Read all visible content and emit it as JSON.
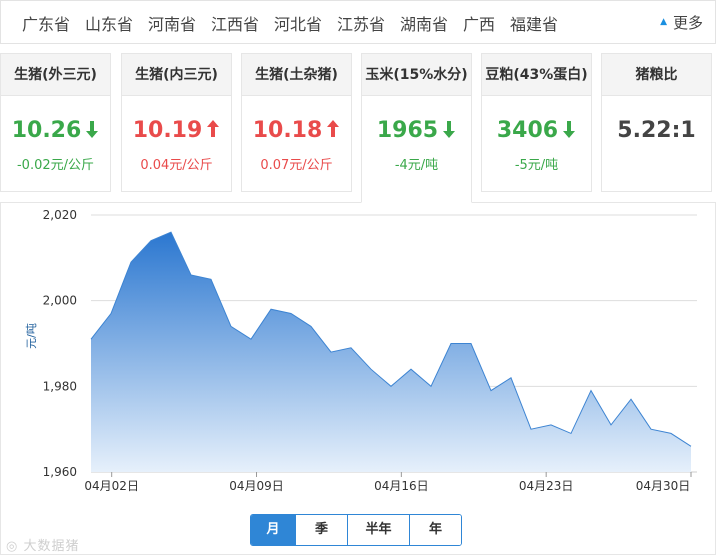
{
  "provinces": [
    "广东省",
    "山东省",
    "河南省",
    "江西省",
    "河北省",
    "江苏省",
    "湖南省",
    "广西",
    "福建省"
  ],
  "more_label": "更多",
  "cards": [
    {
      "title": "生猪(外三元)",
      "price": "10.26",
      "change": "-0.02",
      "unit": "元/公斤",
      "direction": "down"
    },
    {
      "title": "生猪(内三元)",
      "price": "10.19",
      "change": "0.04",
      "unit": "元/公斤",
      "direction": "up"
    },
    {
      "title": "生猪(土杂猪)",
      "price": "10.18",
      "change": "0.07",
      "unit": "元/公斤",
      "direction": "up"
    },
    {
      "title": "玉米(15%水分)",
      "price": "1965",
      "change": "-4",
      "unit": "元/吨",
      "direction": "down"
    },
    {
      "title": "豆粕(43%蛋白)",
      "price": "3406",
      "change": "-5",
      "unit": "元/吨",
      "direction": "down"
    },
    {
      "title": "猪粮比",
      "price": "5.22:1",
      "change": "",
      "unit": "",
      "direction": "none"
    }
  ],
  "periods": [
    "月",
    "季",
    "半年",
    "年"
  ],
  "active_period": "月",
  "watermark": "大数据猪",
  "colors": {
    "accent": "#2f86d6",
    "up": "#e94b4b",
    "down": "#3aa84a",
    "area_top": "#2b77d0",
    "area_bottom": "#e6f0fb"
  },
  "chart_data": {
    "type": "area",
    "ylabel": "元/吨",
    "ylim": [
      1960,
      2020
    ],
    "yticks": [
      1960,
      1980,
      2000,
      2020
    ],
    "ytick_labels": [
      "1,960",
      "1,980",
      "2,000",
      "2,020"
    ],
    "xtick_labels": [
      "04月02日",
      "04月09日",
      "04月16日",
      "04月23日",
      "04月30日"
    ],
    "xtick_days": [
      2,
      9,
      16,
      23,
      30
    ],
    "x": [
      1,
      2,
      3,
      4,
      5,
      6,
      7,
      8,
      9,
      10,
      11,
      12,
      13,
      14,
      15,
      16,
      17,
      18,
      19,
      20,
      21,
      22,
      23,
      24,
      25,
      26,
      27,
      28,
      29,
      30
    ],
    "values": [
      1991,
      1997,
      2009,
      2014,
      2016,
      2006,
      2005,
      1994,
      1991,
      1998,
      1997,
      1994,
      1988,
      1989,
      1984,
      1980,
      1984,
      1980,
      1990,
      1990,
      1979,
      1982,
      1970,
      1971,
      1969,
      1979,
      1971,
      1977,
      1970,
      1969,
      1966
    ],
    "grid": true
  }
}
